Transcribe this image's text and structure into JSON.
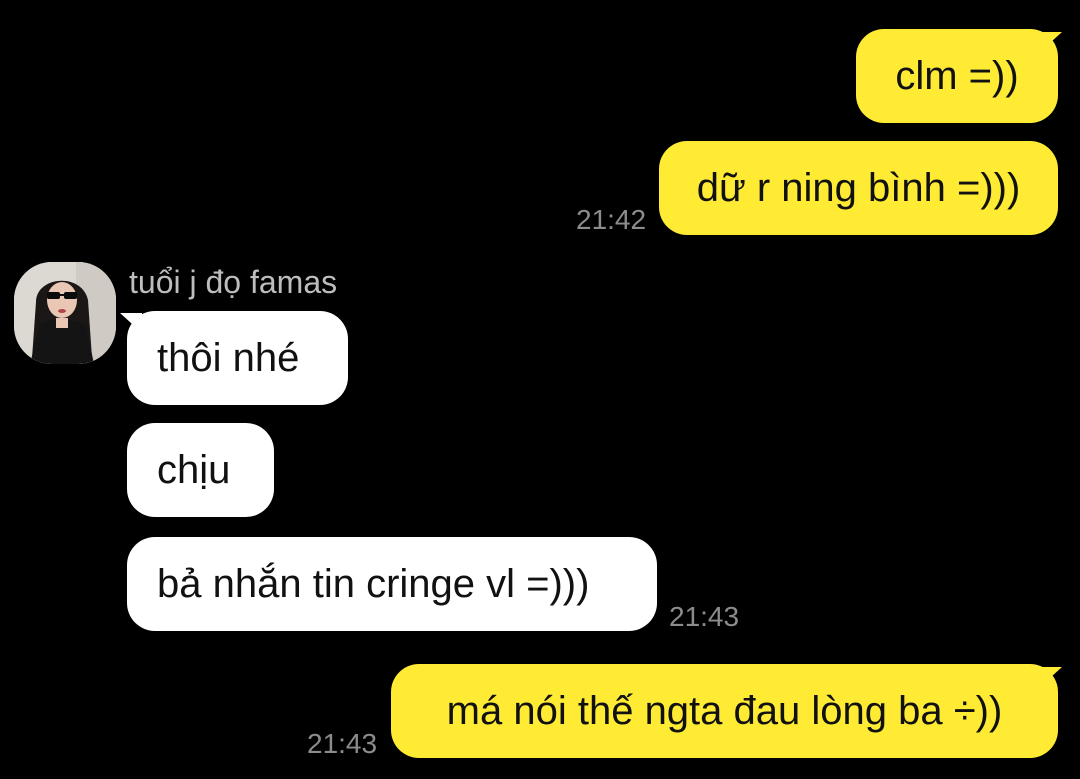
{
  "conversation": {
    "messages": [
      {
        "sender": "me",
        "text": "clm =))"
      },
      {
        "sender": "me",
        "text": "dữ r ning bình =)))",
        "time": "21:42"
      },
      {
        "sender": "contact",
        "text": "thôi nhé"
      },
      {
        "sender": "contact",
        "text": "chịu"
      },
      {
        "sender": "contact",
        "text": "bả nhắn tin cringe vl =)))",
        "time": "21:43"
      },
      {
        "sender": "me",
        "text": "má nói thế ngta đau lòng ba ÷))",
        "time": "21:43"
      }
    ]
  },
  "contact": {
    "name": "tuổi j đọ famas"
  },
  "colors": {
    "background": "#000000",
    "outgoing_bubble": "#FFEB33",
    "incoming_bubble": "#FFFFFF",
    "timestamp": "#8C8C8C",
    "sender_name": "#BDBDBD"
  }
}
